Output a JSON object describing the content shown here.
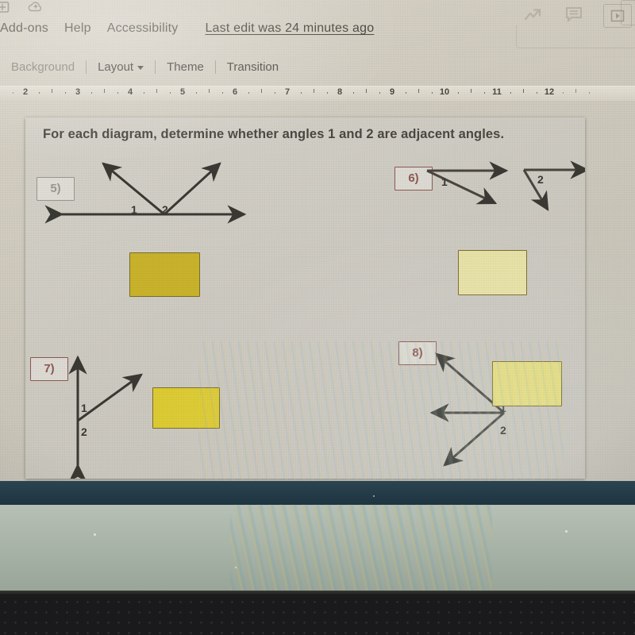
{
  "app": {
    "menu_items": [
      "Add-ons",
      "Help",
      "Accessibility"
    ],
    "last_edit": "Last edit was 24 minutes ago",
    "icons": {
      "slide_icon": "add-slide-icon",
      "cloud_icon": "cloud-save-icon",
      "trend_icon": "explore-trending-icon",
      "comment_icon": "comment-icon",
      "present_icon": "present-play-icon"
    }
  },
  "toolbar": {
    "background_label": "Background",
    "layout_label": "Layout",
    "theme_label": "Theme",
    "transition_label": "Transition"
  },
  "ruler": {
    "numbers": [
      2,
      3,
      4,
      5,
      6,
      7,
      8,
      9,
      10,
      11,
      12
    ]
  },
  "slide": {
    "title": "For each diagram, determine whether angles 1 and 2 are adjacent angles.",
    "problems": [
      {
        "label": "5)",
        "label_color": "#9b9790",
        "angle_labels": [
          "1",
          "2"
        ],
        "answer_box_color": "#c9b32c"
      },
      {
        "label": "6)",
        "label_color": "#8d5a52",
        "angle_labels": [
          "1",
          "2"
        ],
        "answer_box_color": "#e6e1a4"
      },
      {
        "label": "7)",
        "label_color": "#8d5a52",
        "angle_labels": [
          "1",
          "2"
        ],
        "answer_box_color": "#ddcb33"
      },
      {
        "label": "8)",
        "label_color": "#8d5a52",
        "angle_labels": [
          "1",
          "2"
        ],
        "answer_box_color": "#e3dc7e"
      }
    ]
  }
}
